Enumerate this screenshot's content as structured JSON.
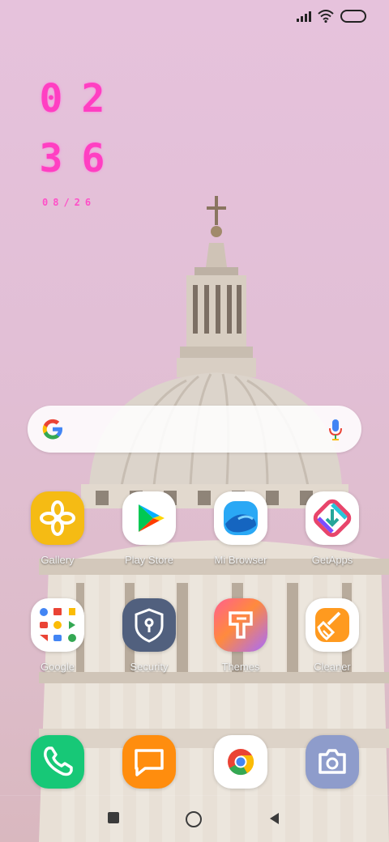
{
  "clock": {
    "hour": [
      "0",
      "2"
    ],
    "minute": [
      "3",
      "6"
    ],
    "date": "08/26"
  },
  "search": {
    "logo": "google-g-icon",
    "mic": "microphone-icon"
  },
  "apps": [
    {
      "label": "Gallery",
      "icon": "gallery-flower-icon"
    },
    {
      "label": "Play Store",
      "icon": "play-store-icon"
    },
    {
      "label": "Mi Browser",
      "icon": "browser-wave-icon"
    },
    {
      "label": "GetApps",
      "icon": "download-icon"
    },
    {
      "label": "Google",
      "icon": "google-folder-icon"
    },
    {
      "label": "Security",
      "icon": "shield-lock-icon"
    },
    {
      "label": "Themes",
      "icon": "paint-brush-icon"
    },
    {
      "label": "Cleaner",
      "icon": "broom-icon"
    }
  ],
  "dock": [
    {
      "icon": "phone-icon"
    },
    {
      "icon": "message-icon"
    },
    {
      "icon": "chrome-icon"
    },
    {
      "icon": "camera-icon"
    }
  ],
  "colors": {
    "accent": "#ff3fc2",
    "background": "#e6c2dc"
  }
}
